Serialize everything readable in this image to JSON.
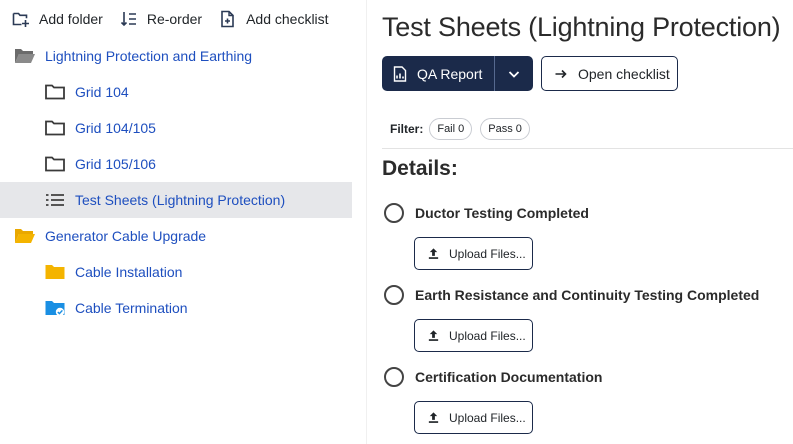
{
  "toolbar": {
    "add_folder": "Add folder",
    "reorder": "Re-order",
    "add_checklist": "Add checklist"
  },
  "tree": [
    {
      "label": "Lightning Protection and Earthing",
      "icon": "folder-open-icon",
      "level": 0,
      "color": "#6b6b6b"
    },
    {
      "label": "Grid 104",
      "icon": "folder-icon",
      "level": 1,
      "color": "#3a3a3a"
    },
    {
      "label": "Grid 104/105",
      "icon": "folder-icon",
      "level": 1,
      "color": "#3a3a3a"
    },
    {
      "label": "Grid 105/106",
      "icon": "folder-icon",
      "level": 1,
      "color": "#3a3a3a"
    },
    {
      "label": "Test Sheets (Lightning Protection)",
      "icon": "list-icon",
      "level": 1,
      "selected": true
    },
    {
      "label": "Generator Cable Upgrade",
      "icon": "folder-open-icon",
      "level": 0,
      "color": "#f4b400"
    },
    {
      "label": "Cable Installation",
      "icon": "folder-icon",
      "level": 1,
      "color": "#f4b400"
    },
    {
      "label": "Cable Termination",
      "icon": "folder-check-icon",
      "level": 1,
      "color": "#1a8fe3"
    }
  ],
  "main": {
    "title": "Test Sheets (Lightning Protection)",
    "qa_report": "QA Report",
    "open_checklist": "Open checklist",
    "filter_label": "Filter:",
    "filter_fail": "Fail 0",
    "filter_pass": "Pass 0",
    "details_heading": "Details:",
    "items": [
      {
        "label": "Ductor Testing Completed",
        "upload": "Upload Files..."
      },
      {
        "label": "Earth Resistance and Continuity Testing Completed",
        "upload": "Upload Files..."
      },
      {
        "label": "Certification Documentation",
        "upload": "Upload Files..."
      }
    ]
  },
  "colors": {
    "accent_navy": "#1b2a4a",
    "link_blue": "#1e4fbf",
    "selected_bg": "#e6e7ea"
  }
}
